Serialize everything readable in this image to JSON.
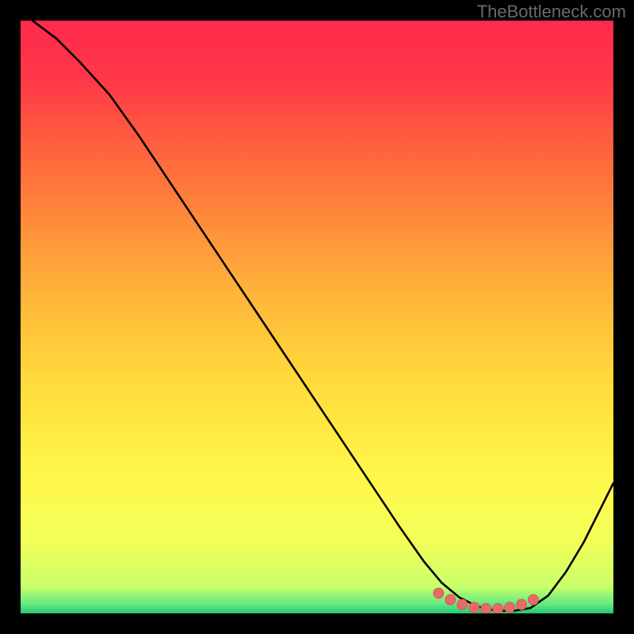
{
  "watermark": "TheBottleneck.com",
  "colors": {
    "gradient_stops": [
      {
        "offset": 0.0,
        "color": "#ff2a4d"
      },
      {
        "offset": 0.1,
        "color": "#ff3846"
      },
      {
        "offset": 0.25,
        "color": "#ff6e3c"
      },
      {
        "offset": 0.45,
        "color": "#ffb13a"
      },
      {
        "offset": 0.6,
        "color": "#ffd93a"
      },
      {
        "offset": 0.78,
        "color": "#fff94b"
      },
      {
        "offset": 0.88,
        "color": "#f1ff58"
      },
      {
        "offset": 0.955,
        "color": "#c9ff6a"
      },
      {
        "offset": 0.985,
        "color": "#61e980"
      },
      {
        "offset": 1.0,
        "color": "#24c476"
      }
    ],
    "curve_color": "#000000",
    "marker_fill": "#e86a66",
    "marker_stroke": "#d65a57"
  },
  "chart_data": {
    "type": "line",
    "title": "",
    "xlabel": "",
    "ylabel": "",
    "xlim": [
      0,
      100
    ],
    "ylim": [
      0,
      100
    ],
    "series": [
      {
        "name": "bottleneck-curve",
        "x": [
          2,
          6,
          10,
          15,
          20,
          25,
          30,
          35,
          40,
          45,
          50,
          55,
          60,
          64,
          68,
          71,
          74,
          77,
          80,
          83,
          86,
          89,
          92,
          95,
          98,
          100
        ],
        "y": [
          100,
          97,
          93,
          87.5,
          80.5,
          73,
          65.5,
          58,
          50.5,
          43,
          35.5,
          28,
          20.5,
          14.5,
          8.8,
          5.2,
          2.7,
          1.2,
          0.5,
          0.4,
          0.9,
          3.0,
          7.0,
          12.0,
          18.0,
          22.0
        ]
      }
    ],
    "markers": {
      "name": "highlight-range",
      "x": [
        70.5,
        72.5,
        74.5,
        76.5,
        78.5,
        80.5,
        82.5,
        84.5,
        86.5
      ],
      "y": [
        3.4,
        2.3,
        1.5,
        1.0,
        0.8,
        0.8,
        1.0,
        1.5,
        2.3
      ]
    }
  }
}
